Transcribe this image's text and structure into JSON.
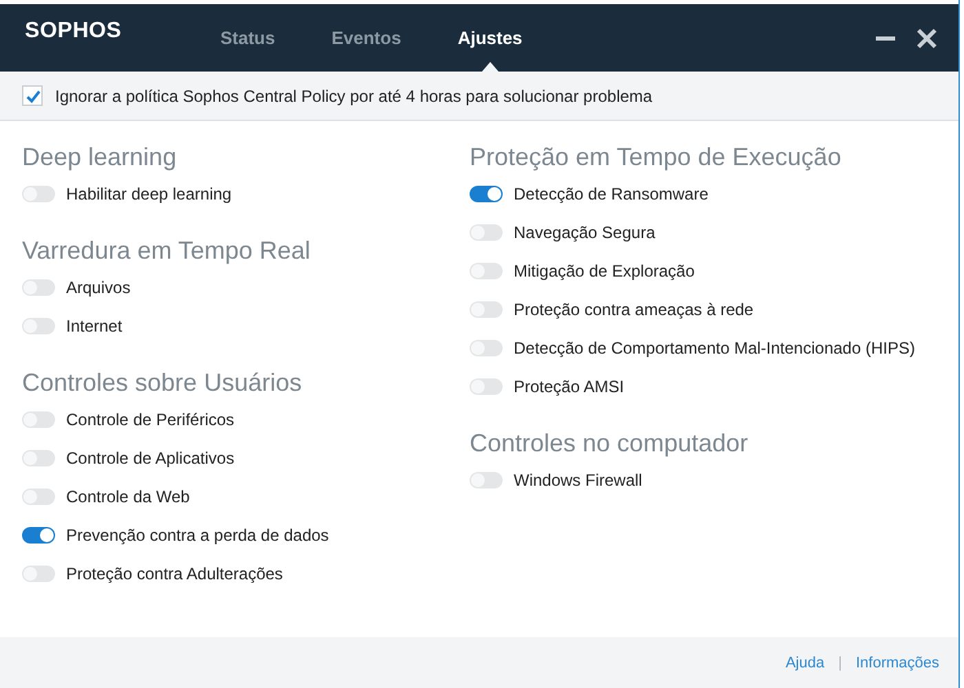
{
  "header": {
    "logo": "SOPHOS",
    "tabs": [
      {
        "label": "Status",
        "selected": false
      },
      {
        "label": "Eventos",
        "selected": false
      },
      {
        "label": "Ajustes",
        "selected": true
      }
    ]
  },
  "policy": {
    "label": "Ignorar a política Sophos Central Policy por até 4 horas para solucionar problema",
    "checked": true
  },
  "columns": [
    [
      {
        "title": "Deep learning",
        "items": [
          {
            "label": "Habilitar deep learning",
            "on": false
          }
        ]
      },
      {
        "title": "Varredura em Tempo Real",
        "items": [
          {
            "label": "Arquivos",
            "on": false
          },
          {
            "label": "Internet",
            "on": false
          }
        ]
      },
      {
        "title": "Controles sobre Usuários",
        "items": [
          {
            "label": "Controle de Periféricos",
            "on": false
          },
          {
            "label": "Controle de Aplicativos",
            "on": false
          },
          {
            "label": "Controle da Web",
            "on": false
          },
          {
            "label": "Prevenção contra a perda de dados",
            "on": true
          },
          {
            "label": "Proteção contra Adulterações",
            "on": false
          }
        ]
      }
    ],
    [
      {
        "title": "Proteção em Tempo de Execução",
        "items": [
          {
            "label": "Detecção de Ransomware",
            "on": true
          },
          {
            "label": "Navegação Segura",
            "on": false
          },
          {
            "label": "Mitigação de Exploração",
            "on": false
          },
          {
            "label": "Proteção contra ameaças à rede",
            "on": false
          },
          {
            "label": "Detecção de Comportamento Mal-Intencionado (HIPS)",
            "on": false
          },
          {
            "label": "Proteção AMSI",
            "on": false
          }
        ]
      },
      {
        "title": "Controles no computador",
        "items": [
          {
            "label": "Windows Firewall",
            "on": false
          }
        ]
      }
    ]
  ],
  "footer": {
    "links": [
      "Ajuda",
      "Informações"
    ],
    "separator": "|"
  }
}
